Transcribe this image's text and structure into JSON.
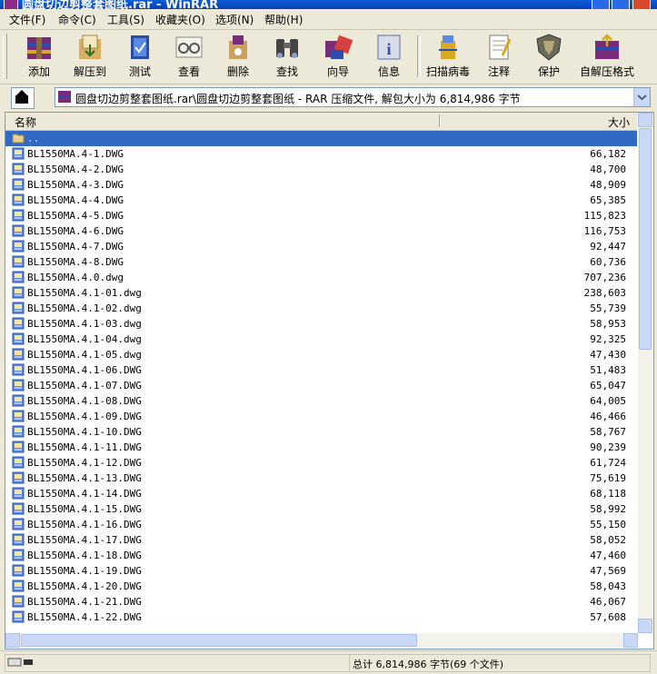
{
  "window": {
    "title": "圆盘切边剪整套图纸.rar - WinRAR"
  },
  "menu": [
    "文件(F)",
    "命令(C)",
    "工具(S)",
    "收藏夹(O)",
    "选项(N)",
    "帮助(H)"
  ],
  "toolbar": {
    "add": "添加",
    "extract": "解压到",
    "test": "测试",
    "view": "查看",
    "delete": "删除",
    "find": "查找",
    "wizard": "向导",
    "info": "信息",
    "scan": "扫描病毒",
    "comment": "注释",
    "protect": "保护",
    "sfx": "自解压格式"
  },
  "address": {
    "text": "圆盘切边剪整套图纸.rar\\圆盘切边剪整套图纸 - RAR 压缩文件, 解包大小为 6,814,986 字节"
  },
  "list": {
    "col_name": "名称",
    "col_size": "大小",
    "parent": "..",
    "rows": [
      {
        "name": "BL1550MA.4-1.DWG",
        "size": "66,182"
      },
      {
        "name": "BL1550MA.4-2.DWG",
        "size": "48,700"
      },
      {
        "name": "BL1550MA.4-3.DWG",
        "size": "48,909"
      },
      {
        "name": "BL1550MA.4-4.DWG",
        "size": "65,385"
      },
      {
        "name": "BL1550MA.4-5.DWG",
        "size": "115,823"
      },
      {
        "name": "BL1550MA.4-6.DWG",
        "size": "116,753"
      },
      {
        "name": "BL1550MA.4-7.DWG",
        "size": "92,447"
      },
      {
        "name": "BL1550MA.4-8.DWG",
        "size": "60,736"
      },
      {
        "name": "BL1550MA.4.0.dwg",
        "size": "707,236"
      },
      {
        "name": "BL1550MA.4.1-01.dwg",
        "size": "238,603"
      },
      {
        "name": "BL1550MA.4.1-02.dwg",
        "size": "55,739"
      },
      {
        "name": "BL1550MA.4.1-03.dwg",
        "size": "58,953"
      },
      {
        "name": "BL1550MA.4.1-04.dwg",
        "size": "92,325"
      },
      {
        "name": "BL1550MA.4.1-05.dwg",
        "size": "47,430"
      },
      {
        "name": "BL1550MA.4.1-06.DWG",
        "size": "51,483"
      },
      {
        "name": "BL1550MA.4.1-07.DWG",
        "size": "65,047"
      },
      {
        "name": "BL1550MA.4.1-08.DWG",
        "size": "64,005"
      },
      {
        "name": "BL1550MA.4.1-09.DWG",
        "size": "46,466"
      },
      {
        "name": "BL1550MA.4.1-10.DWG",
        "size": "58,767"
      },
      {
        "name": "BL1550MA.4.1-11.DWG",
        "size": "90,239"
      },
      {
        "name": "BL1550MA.4.1-12.DWG",
        "size": "61,724"
      },
      {
        "name": "BL1550MA.4.1-13.DWG",
        "size": "75,619"
      },
      {
        "name": "BL1550MA.4.1-14.DWG",
        "size": "68,118"
      },
      {
        "name": "BL1550MA.4.1-15.DWG",
        "size": "58,992"
      },
      {
        "name": "BL1550MA.4.1-16.DWG",
        "size": "55,150"
      },
      {
        "name": "BL1550MA.4.1-17.DWG",
        "size": "58,052"
      },
      {
        "name": "BL1550MA.4.1-18.DWG",
        "size": "47,460"
      },
      {
        "name": "BL1550MA.4.1-19.DWG",
        "size": "47,569"
      },
      {
        "name": "BL1550MA.4.1-20.DWG",
        "size": "58,043"
      },
      {
        "name": "BL1550MA.4.1-21.DWG",
        "size": "46,067"
      },
      {
        "name": "BL1550MA.4.1-22.DWG",
        "size": "57,608"
      }
    ]
  },
  "status": {
    "total": "总计 6,814,986 字节(69 个文件)"
  },
  "icons": {
    "folder": "folder-icon",
    "file": "dwg-file-icon",
    "up": "up-folder-icon",
    "archive": "winrar-archive-icon",
    "dropdown": "chevron-down-icon"
  },
  "colors": {
    "title_bar": "#0A5FD8",
    "selection": "#316AC5",
    "chrome": "#ECE9D8"
  }
}
